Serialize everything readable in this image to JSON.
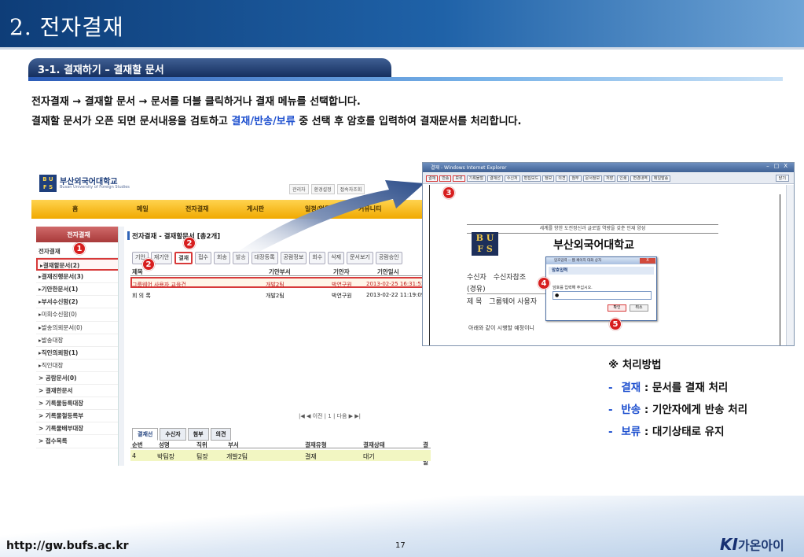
{
  "slide": {
    "title": "2. 전자결재",
    "section": "3-1. 결재하기 – 결재할 문서",
    "desc1": "전자결재 → 결재할 문서 → 문서를 더블 클릭하거나 결재 메뉴를 선택합니다.",
    "desc2_pre": "결재할 문서가 오픈 되면 문서내용을 검토하고 ",
    "desc2_hl": "결재/반송/보류",
    "desc2_post": " 중 선택 후 암호를 입력하여 결재문서를 처리합니다."
  },
  "portal": {
    "logo_mark": "B U\nF S",
    "logo_name": "부산외국어대학교",
    "logo_sub": "Busan University of Foreign Studies",
    "top_links": [
      "관리자",
      "환경설정",
      "접속자조회"
    ],
    "gnb": [
      "홈",
      "메일",
      "전자결재",
      "게시판",
      "일정/업무",
      "커뮤니티"
    ],
    "lnb_head": "전자결재",
    "lnb": [
      {
        "label": "전자결재",
        "bold": true
      },
      {
        "label": "▸결재할문서(2)",
        "bold": true,
        "hl": true
      },
      {
        "label": "▸결재진행문서(3)",
        "bold": true
      },
      {
        "label": "▸기안한문서(1)",
        "bold": true
      },
      {
        "label": "▸부서수신함(2)",
        "bold": true
      },
      {
        "label": "▸미회수신함(0)"
      },
      {
        "label": "▸발송의뢰문서(0)"
      },
      {
        "label": "▸발송대장"
      },
      {
        "label": "▸직인의뢰함(1)",
        "bold": true
      },
      {
        "label": "▸직인대장"
      },
      {
        "label": "> 공람문서(0)",
        "bold": true
      },
      {
        "label": "> 결재한문서",
        "bold": true
      },
      {
        "label": "> 기록물등록대장",
        "bold": true
      },
      {
        "label": "> 기록물철등록부",
        "bold": true
      },
      {
        "label": "> 기록물배부대장",
        "bold": true
      },
      {
        "label": "> 접수목록",
        "bold": true
      }
    ],
    "doc_title": "전자결재 - 결재할문서 [총2개]",
    "toolbar": [
      "기안",
      "재기안",
      "결재",
      "접수",
      "회송",
      "발송",
      "대장등록",
      "공람정보",
      "회수",
      "삭제",
      "문서보기",
      "공람승인"
    ],
    "grid_headers": [
      "제목",
      "기안부서",
      "기안자",
      "기안일시"
    ],
    "rows": [
      {
        "title": "그룹웨어 사용자 교육건",
        "dept": "개발2팀",
        "author": "박연구원",
        "date": "2013-02-25 16:31:52"
      },
      {
        "title": "회 의 록",
        "dept": "개발2팀",
        "author": "박연구원",
        "date": "2013-02-22 11:19:09"
      }
    ],
    "pager": "|◀ ◀ 이전 | 1 | 다음 ▶ ▶|",
    "tabs": [
      "결재선",
      "수신자",
      "첨부",
      "의견"
    ],
    "g2_headers": [
      "순번",
      "성명",
      "직위",
      "부서",
      "결재유형",
      "결재상태",
      "결재일시"
    ],
    "g2_row": [
      "4",
      "박팀장",
      "팀장",
      "개발2팀",
      "결재",
      "대기",
      ""
    ]
  },
  "viewer": {
    "window_title": "결재 - Windows Internet Explorer",
    "window_ctrl": "–□X",
    "buttons": [
      "결재",
      "반송",
      "보류",
      "기록물철",
      "결재선",
      "수신처",
      "편집모드",
      "정보",
      "의견",
      "첨부",
      "문서정보",
      "저장",
      "인쇄",
      "변경내역",
      "메일발송"
    ],
    "close_label": "닫기",
    "motto": "세계를 향한 도전정신과 글로벌 역량을 갖춘 인재 양성",
    "fs_mark": "B U\nF S",
    "univ": "부산외국어대학교",
    "recv_label": "수신자",
    "recv_value": "수신자참조",
    "via_label": "(경유)",
    "subj_label": "제  목",
    "subj_value": "그룹웨어 사용자",
    "note": "아래와 같이 시행할 예정이니"
  },
  "dialog": {
    "title": "암호입력 -- 웹 페이지 대화 상자",
    "close": "X",
    "head": "암호입력",
    "prompt": "암호를 입력해 주십시오.",
    "value": "●",
    "ok": "확인",
    "cancel": "취소"
  },
  "badges": [
    "1",
    "2",
    "2",
    "3",
    "4",
    "5"
  ],
  "notes": {
    "title": "※ 처리방법",
    "items": [
      {
        "dash": "-",
        "key": "결재",
        "text": " : 문서를 결재 처리"
      },
      {
        "dash": "-",
        "key": "반송",
        "text": " : 기안자에게 반송 처리"
      },
      {
        "dash": "-",
        "key": "보류",
        "text": " : 대기상태로 유지"
      }
    ]
  },
  "footer": {
    "url": "http://gw.bufs.ac.kr",
    "page": "17",
    "brand_k": "KI",
    "brand_name": "가온아이"
  },
  "colors": {
    "accent_blue": "#1d4fcf",
    "marker_red": "#d71f1f",
    "gnb_yellow": "#f0a900"
  }
}
